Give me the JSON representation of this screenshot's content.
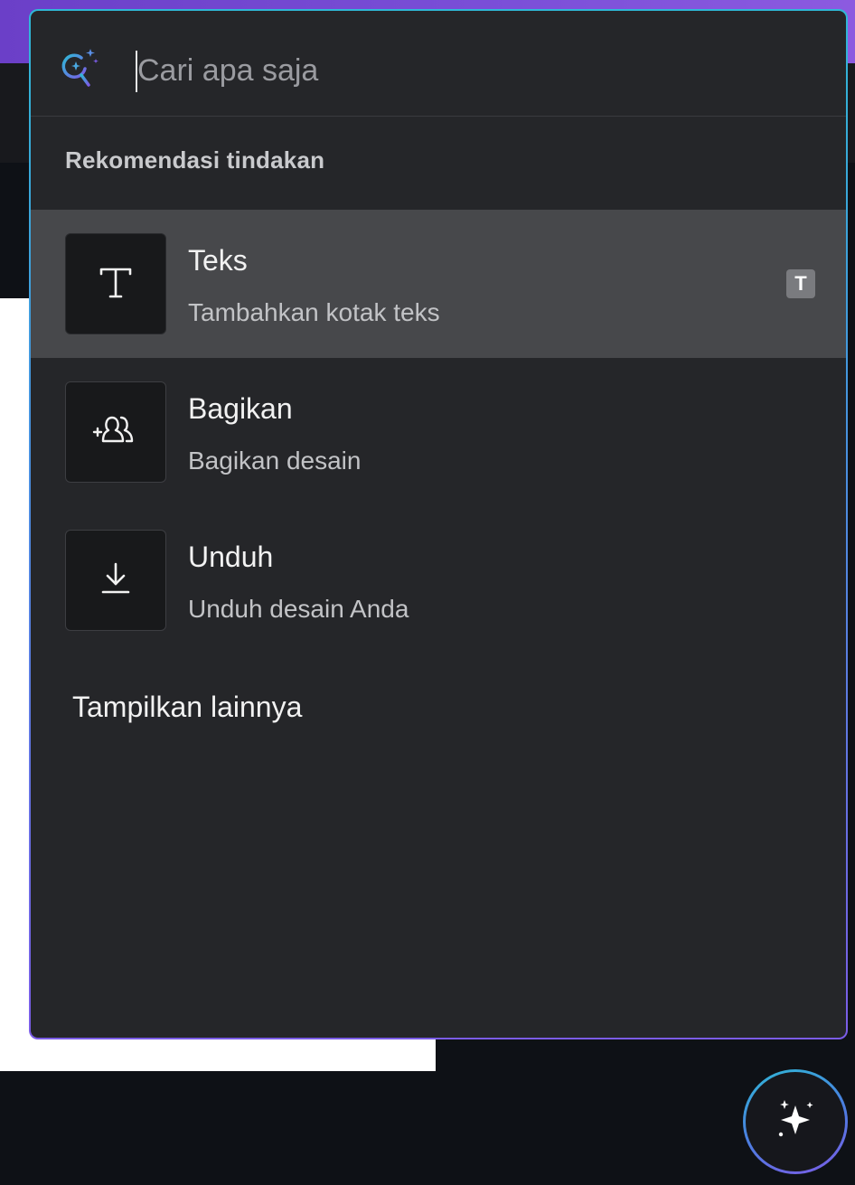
{
  "search": {
    "placeholder": "Cari apa saja",
    "icon": "magic-search-icon"
  },
  "section": {
    "heading": "Rekomendasi tindakan"
  },
  "actions": [
    {
      "title": "Teks",
      "subtitle": "Tambahkan kotak teks",
      "icon": "text-icon",
      "shortcut": "T",
      "selected": true
    },
    {
      "title": "Bagikan",
      "subtitle": "Bagikan desain",
      "icon": "share-people-icon",
      "shortcut": "",
      "selected": false
    },
    {
      "title": "Unduh",
      "subtitle": "Unduh desain Anda",
      "icon": "download-icon",
      "shortcut": "",
      "selected": false
    }
  ],
  "show_more_label": "Tampilkan lainnya",
  "fab": {
    "icon": "sparkle-icon"
  },
  "colors": {
    "panel_bg": "#252629",
    "selected_row_bg": "#47484b",
    "accent_cyan": "#2fb8d6",
    "accent_purple": "#7b5ce6",
    "top_bar": "#7b4fd8"
  }
}
